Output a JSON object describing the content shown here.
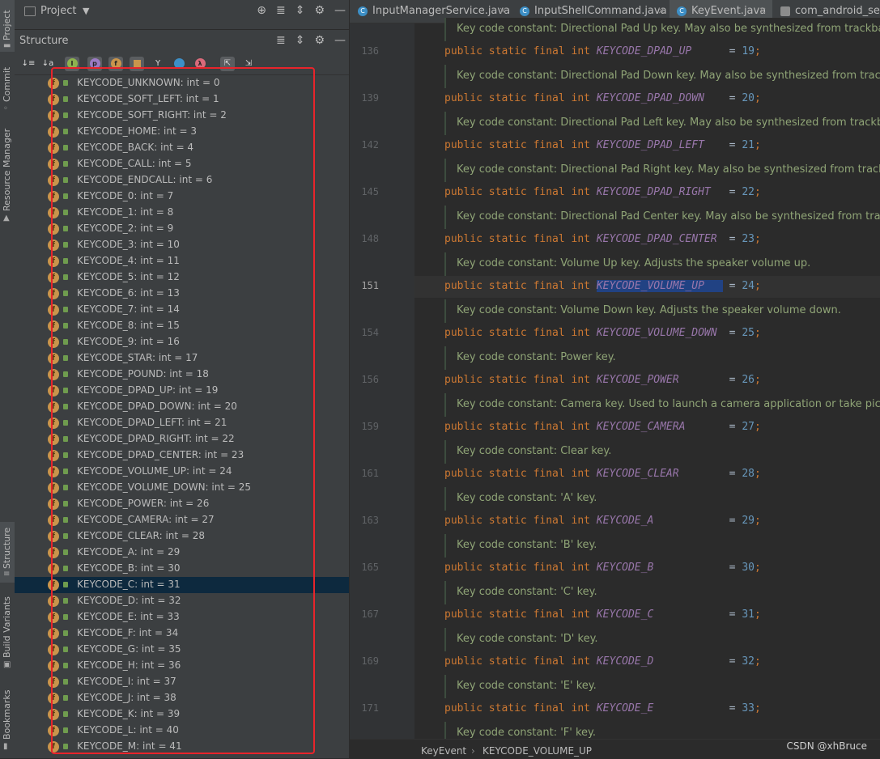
{
  "toolstrip": {
    "tabs": [
      "Project",
      "Commit",
      "Resource Manager",
      "Structure",
      "Build Variants",
      "Bookmarks"
    ]
  },
  "project_header": {
    "title": "Project"
  },
  "structure_header": {
    "title": "Structure"
  },
  "structure_tree": [
    "KEYCODE_UNKNOWN: int = 0",
    "KEYCODE_SOFT_LEFT: int = 1",
    "KEYCODE_SOFT_RIGHT: int = 2",
    "KEYCODE_HOME: int = 3",
    "KEYCODE_BACK: int = 4",
    "KEYCODE_CALL: int = 5",
    "KEYCODE_ENDCALL: int = 6",
    "KEYCODE_0: int = 7",
    "KEYCODE_1: int = 8",
    "KEYCODE_2: int = 9",
    "KEYCODE_3: int = 10",
    "KEYCODE_4: int = 11",
    "KEYCODE_5: int = 12",
    "KEYCODE_6: int = 13",
    "KEYCODE_7: int = 14",
    "KEYCODE_8: int = 15",
    "KEYCODE_9: int = 16",
    "KEYCODE_STAR: int = 17",
    "KEYCODE_POUND: int = 18",
    "KEYCODE_DPAD_UP: int = 19",
    "KEYCODE_DPAD_DOWN: int = 20",
    "KEYCODE_DPAD_LEFT: int = 21",
    "KEYCODE_DPAD_RIGHT: int = 22",
    "KEYCODE_DPAD_CENTER: int = 23",
    "KEYCODE_VOLUME_UP: int = 24",
    "KEYCODE_VOLUME_DOWN: int = 25",
    "KEYCODE_POWER: int = 26",
    "KEYCODE_CAMERA: int = 27",
    "KEYCODE_CLEAR: int = 28",
    "KEYCODE_A: int = 29",
    "KEYCODE_B: int = 30",
    "KEYCODE_C: int = 31",
    "KEYCODE_D: int = 32",
    "KEYCODE_E: int = 33",
    "KEYCODE_F: int = 34",
    "KEYCODE_G: int = 35",
    "KEYCODE_H: int = 36",
    "KEYCODE_I: int = 37",
    "KEYCODE_J: int = 38",
    "KEYCODE_K: int = 39",
    "KEYCODE_L: int = 40",
    "KEYCODE_M: int = 41"
  ],
  "selected_item": "KEYCODE_C: int = 31",
  "editor_tabs": [
    {
      "name": "InputManagerService.java",
      "active": false
    },
    {
      "name": "InputShellCommand.java",
      "active": false
    },
    {
      "name": "KeyEvent.java",
      "active": true
    },
    {
      "name": "com_android_serv",
      "active": false
    }
  ],
  "top_doc": "Key code constant: Directional Pad Up key. May also be synthesized from trackball m",
  "code_blocks": [
    {
      "line": "136",
      "field": "KEYCODE_DPAD_UP",
      "value": "19",
      "doc": "Key code constant: Directional Pad Down key. May also be synthesized from trackball"
    },
    {
      "line": "139",
      "field": "KEYCODE_DPAD_DOWN",
      "value": "20",
      "doc": "Key code constant: Directional Pad Left key. May also be synthesized from trackball m"
    },
    {
      "line": "142",
      "field": "KEYCODE_DPAD_LEFT",
      "value": "21",
      "doc": "Key code constant: Directional Pad Right key. May also be synthesized from trackball"
    },
    {
      "line": "145",
      "field": "KEYCODE_DPAD_RIGHT",
      "value": "22",
      "doc": "Key code constant: Directional Pad Center key. May also be synthesized from trackba"
    },
    {
      "line": "148",
      "field": "KEYCODE_DPAD_CENTER",
      "value": "23",
      "doc": "Key code constant: Volume Up key. Adjusts the speaker volume up."
    },
    {
      "line": "151",
      "field": "KEYCODE_VOLUME_UP",
      "value": "24",
      "doc": "Key code constant: Volume Down key. Adjusts the speaker volume down."
    },
    {
      "line": "154",
      "field": "KEYCODE_VOLUME_DOWN",
      "value": "25",
      "doc": "Key code constant: Power key."
    },
    {
      "line": "156",
      "field": "KEYCODE_POWER",
      "value": "26",
      "doc": "Key code constant: Camera key. Used to launch a camera application or take pictures"
    },
    {
      "line": "159",
      "field": "KEYCODE_CAMERA",
      "value": "27",
      "doc": "Key code constant: Clear key."
    },
    {
      "line": "161",
      "field": "KEYCODE_CLEAR",
      "value": "28",
      "doc": "Key code constant: 'A' key."
    },
    {
      "line": "163",
      "field": "KEYCODE_A",
      "value": "29",
      "doc": "Key code constant: 'B' key."
    },
    {
      "line": "165",
      "field": "KEYCODE_B",
      "value": "30",
      "doc": "Key code constant: 'C' key."
    },
    {
      "line": "167",
      "field": "KEYCODE_C",
      "value": "31",
      "doc": "Key code constant: 'D' key."
    },
    {
      "line": "169",
      "field": "KEYCODE_D",
      "value": "32",
      "doc": "Key code constant: 'E' key."
    },
    {
      "line": "171",
      "field": "KEYCODE_E",
      "value": "33",
      "doc": "Key code constant: 'F' key."
    }
  ],
  "code_keywords": "public static final int",
  "current_line": "151",
  "breadcrumb": [
    "KeyEvent",
    "KEYCODE_VOLUME_UP"
  ],
  "watermark": "CSDN @xhBruce",
  "colors": {
    "highlight_box": "#e8242b",
    "keyword": "#cc7832",
    "field": "#9876aa",
    "number": "#6897bb",
    "doc_text": "#8fa476",
    "selection": "#0d293e"
  }
}
